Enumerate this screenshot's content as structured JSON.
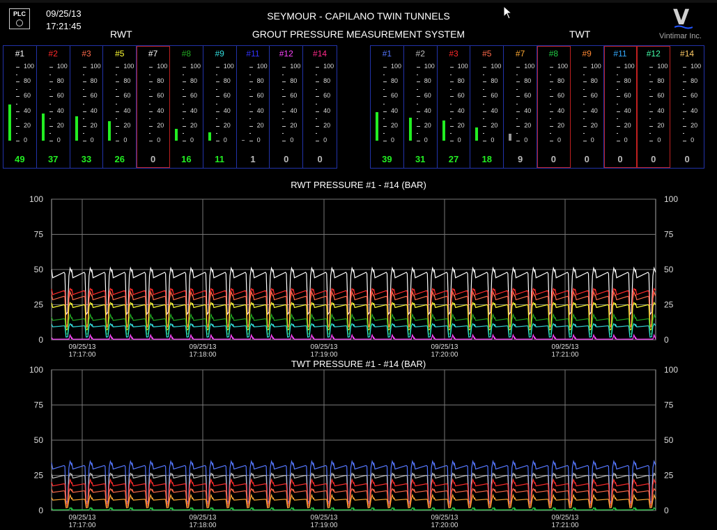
{
  "header": {
    "plc_label": "PLC",
    "date": "09/25/13",
    "time": "17:21:45",
    "title": "SEYMOUR - CAPILANO TWIN TUNNELS",
    "subtitle": "GROUT PRESSURE MEASUREMENT SYSTEM",
    "group_left": "RWT",
    "group_right": "TWT",
    "logo_letter": "V",
    "logo_text": "Vintimar Inc."
  },
  "gauge_scale": [
    "100",
    "80",
    "60",
    "40",
    "20",
    "0"
  ],
  "rwt_gauges": [
    {
      "label": "#1",
      "color": "#ffffff",
      "value": 49,
      "value_text": "49",
      "alarm": false
    },
    {
      "label": "#2",
      "color": "#ff2a2a",
      "value": 37,
      "value_text": "37",
      "alarm": false
    },
    {
      "label": "#3",
      "color": "#ff6a4a",
      "value": 33,
      "value_text": "33",
      "alarm": false
    },
    {
      "label": "#5",
      "color": "#ffff33",
      "value": 26,
      "value_text": "26",
      "alarm": false
    },
    {
      "label": "#7",
      "color": "#ffffff",
      "value": 0,
      "value_text": "0",
      "alarm": true
    },
    {
      "label": "#8",
      "color": "#22aa22",
      "value": 16,
      "value_text": "16",
      "alarm": false
    },
    {
      "label": "#9",
      "color": "#33dddd",
      "value": 11,
      "value_text": "11",
      "alarm": false
    },
    {
      "label": "#11",
      "color": "#3333ff",
      "value": 1,
      "value_text": "1",
      "alarm": false
    },
    {
      "label": "#12",
      "color": "#ff44ff",
      "value": 0,
      "value_text": "0",
      "alarm": false
    },
    {
      "label": "#14",
      "color": "#ff2a8a",
      "value": 0,
      "value_text": "0",
      "alarm": false
    }
  ],
  "twt_gauges": [
    {
      "label": "#1",
      "color": "#5577ff",
      "value": 39,
      "value_text": "39",
      "alarm": false
    },
    {
      "label": "#2",
      "color": "#bbbbbb",
      "value": 31,
      "value_text": "31",
      "alarm": false
    },
    {
      "label": "#3",
      "color": "#ff2a2a",
      "value": 27,
      "value_text": "27",
      "alarm": false
    },
    {
      "label": "#5",
      "color": "#ff6a4a",
      "value": 18,
      "value_text": "18",
      "alarm": false
    },
    {
      "label": "#7",
      "color": "#ffaa33",
      "value": 9,
      "value_text": "9",
      "alarm": false
    },
    {
      "label": "#8",
      "color": "#22cc44",
      "value": 0,
      "value_text": "0",
      "alarm": true
    },
    {
      "label": "#9",
      "color": "#ff8833",
      "value": 0,
      "value_text": "0",
      "alarm": false
    },
    {
      "label": "#11",
      "color": "#33aaff",
      "value": 0,
      "value_text": "0",
      "alarm": true
    },
    {
      "label": "#12",
      "color": "#44ffaa",
      "value": 0,
      "value_text": "0",
      "alarm": true
    },
    {
      "label": "#14",
      "color": "#ffcc66",
      "value": 0,
      "value_text": "0",
      "alarm": false
    }
  ],
  "chart_data": [
    {
      "type": "line",
      "title": "RWT PRESSURE #1 - #14 (BAR)",
      "ylim": [
        0,
        100
      ],
      "yticks": [
        "100",
        "75",
        "50",
        "25",
        "0"
      ],
      "xticks": [
        {
          "date": "09/25/13",
          "time": "17:17:00"
        },
        {
          "date": "09/25/13",
          "time": "17:18:00"
        },
        {
          "date": "09/25/13",
          "time": "17:19:00"
        },
        {
          "date": "09/25/13",
          "time": "17:20:00"
        },
        {
          "date": "09/25/13",
          "time": "17:21:00"
        }
      ],
      "cycles": 30,
      "series": [
        {
          "color": "#ffffff",
          "level": 48,
          "low": 18
        },
        {
          "color": "#ff2a2a",
          "level": 35,
          "low": 10
        },
        {
          "color": "#ff6a4a",
          "level": 31,
          "low": 9
        },
        {
          "color": "#ffff33",
          "level": 25,
          "low": 7
        },
        {
          "color": "#22aa22",
          "level": 15,
          "low": 4
        },
        {
          "color": "#33dddd",
          "level": 10,
          "low": 2
        },
        {
          "color": "#ff44ff",
          "level": 0.5,
          "low": 0.5
        }
      ]
    },
    {
      "type": "line",
      "title": "TWT PRESSURE #1 - #14 (BAR)",
      "ylim": [
        0,
        100
      ],
      "yticks": [
        "100",
        "75",
        "50",
        "25",
        "0"
      ],
      "xticks": [
        {
          "date": "09/25/13",
          "time": "17:17:00"
        },
        {
          "date": "09/25/13",
          "time": "17:18:00"
        },
        {
          "date": "09/25/13",
          "time": "17:19:00"
        },
        {
          "date": "09/25/13",
          "time": "17:20:00"
        },
        {
          "date": "09/25/13",
          "time": "17:21:00"
        }
      ],
      "cycles": 30,
      "series": [
        {
          "color": "#5577ff",
          "level": 32,
          "low": 6
        },
        {
          "color": "#bbbbbb",
          "level": 25,
          "low": 5
        },
        {
          "color": "#ff2a2a",
          "level": 19,
          "low": 4
        },
        {
          "color": "#ff6a4a",
          "level": 14,
          "low": 3
        },
        {
          "color": "#ffaa33",
          "level": 8,
          "low": 2
        },
        {
          "color": "#22cc44",
          "level": 0.5,
          "low": 0.5
        }
      ]
    }
  ]
}
